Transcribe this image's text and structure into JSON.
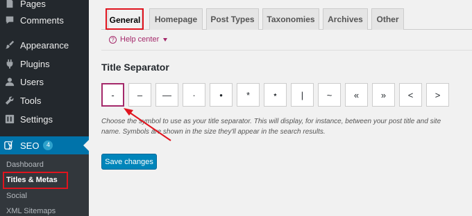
{
  "sidebar": {
    "items": [
      {
        "label": "Pages",
        "icon": "pages-icon"
      },
      {
        "label": "Comments",
        "icon": "comments-icon"
      },
      {
        "label": "Appearance",
        "icon": "appearance-icon"
      },
      {
        "label": "Plugins",
        "icon": "plugins-icon"
      },
      {
        "label": "Users",
        "icon": "users-icon"
      },
      {
        "label": "Tools",
        "icon": "tools-icon"
      },
      {
        "label": "Settings",
        "icon": "settings-icon"
      }
    ],
    "seo": {
      "label": "SEO",
      "badge": "4",
      "icon": "yoast-icon"
    },
    "submenu": [
      {
        "label": "Dashboard"
      },
      {
        "label": "Titles & Metas"
      },
      {
        "label": "Social"
      },
      {
        "label": "XML Sitemaps"
      }
    ]
  },
  "tabs": [
    {
      "label": "General"
    },
    {
      "label": "Homepage"
    },
    {
      "label": "Post Types"
    },
    {
      "label": "Taxonomies"
    },
    {
      "label": "Archives"
    },
    {
      "label": "Other"
    }
  ],
  "help": {
    "label": "Help center"
  },
  "section": {
    "title": "Title Separator"
  },
  "separators": [
    "-",
    "–",
    "—",
    "·",
    "•",
    "*",
    "⋆",
    "|",
    "~",
    "«",
    "»",
    "<",
    ">"
  ],
  "description": "Choose the symbol to use as your title separator. This will display, for instance, between your post title and site name. Symbols are shown in the size they'll appear in the search results.",
  "save_label": "Save changes",
  "colors": {
    "highlight": "#e0141e",
    "accent": "#a4286a",
    "primary": "#0085ba"
  }
}
